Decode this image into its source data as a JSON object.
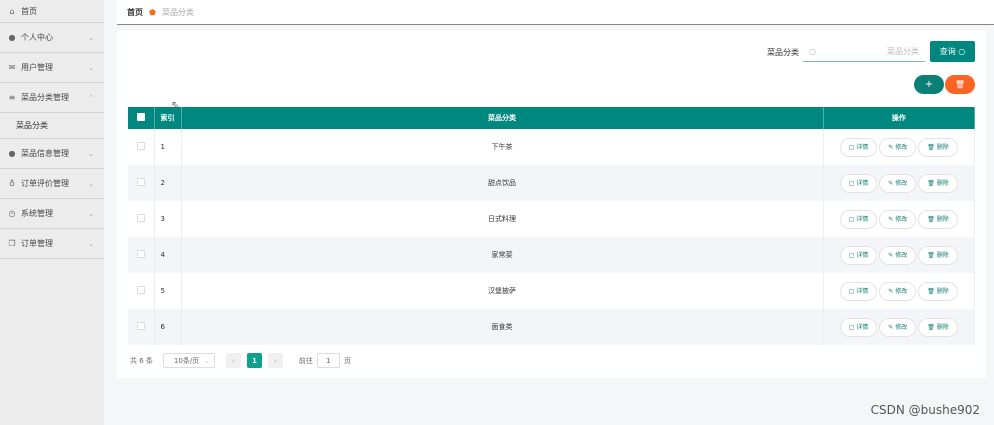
{
  "sidebar": {
    "items": [
      {
        "label": "首页",
        "icon": "home-icon",
        "glyph": "⌂"
      },
      {
        "label": "个人中心",
        "icon": "user-icon",
        "glyph": "●",
        "chev": "⌄"
      },
      {
        "label": "用户管理",
        "icon": "mail-icon",
        "glyph": "✉",
        "chev": "⌄"
      },
      {
        "label": "菜品分类管理",
        "icon": "menu-icon",
        "glyph": "≡",
        "chev": "⌃"
      },
      {
        "label": "菜品信息管理",
        "icon": "pin-icon",
        "glyph": "●",
        "chev": "⌄"
      },
      {
        "label": "订单评价管理",
        "icon": "mic-icon",
        "glyph": "♁",
        "chev": "⌄"
      },
      {
        "label": "系统管理",
        "icon": "compass-icon",
        "glyph": "◷",
        "chev": "⌄"
      },
      {
        "label": "订单管理",
        "icon": "copy-icon",
        "glyph": "❐",
        "chev": "⌄"
      }
    ],
    "sub": "菜品分类"
  },
  "breadcrumb": {
    "home": "首页",
    "current": "菜品分类"
  },
  "search": {
    "label": "菜品分类",
    "placeholder": "菜品分类",
    "button": "查询"
  },
  "toolbar": {
    "add": "+",
    "delete": "🗑"
  },
  "table": {
    "headers": [
      "索引",
      "菜品分类",
      "操作"
    ],
    "rows": [
      {
        "index": "1",
        "name": "下午茶"
      },
      {
        "index": "2",
        "name": "甜点饮品"
      },
      {
        "index": "3",
        "name": "日式料理"
      },
      {
        "index": "4",
        "name": "家常菜"
      },
      {
        "index": "5",
        "name": "汉堡披萨"
      },
      {
        "index": "6",
        "name": "面食类"
      }
    ],
    "actions": [
      "详情",
      "修改",
      "删除"
    ]
  },
  "pagination": {
    "total": "共 6 条",
    "page_size": "10条/页",
    "prev": "‹",
    "current": "1",
    "next": "›",
    "goto_label": "前往",
    "goto_value": "1",
    "goto_suffix": "页"
  },
  "watermark": "CSDN @bushe902",
  "colors": {
    "primary": "#00877f",
    "danger": "#fb6424"
  }
}
